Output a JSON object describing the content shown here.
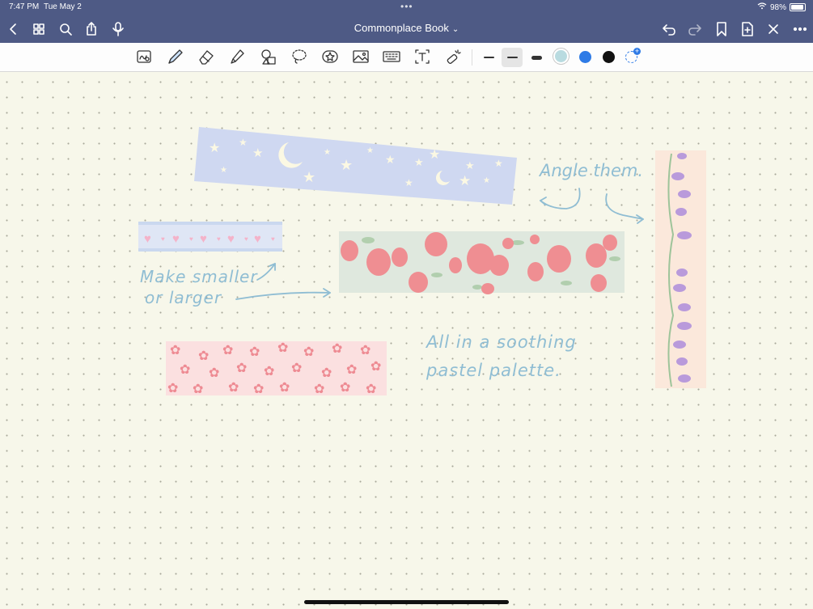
{
  "status": {
    "time": "7:47 PM",
    "date": "Tue May 2",
    "battery": "98%"
  },
  "header": {
    "title": "Commonplace Book"
  },
  "annotations": {
    "angle": "Angle them.",
    "resize_line1": "Make smaller",
    "resize_line2": "or larger",
    "palette_line1": "All in a soothing",
    "palette_line2": "pastel palette."
  },
  "colors": {
    "bar": "#4e5a85",
    "ink": "#8fbdd3",
    "swatches": [
      "#b9dbe0",
      "#2f7be6",
      "#111111"
    ]
  },
  "icons": [
    "back-icon",
    "grid-icon",
    "search-icon",
    "share-icon",
    "mic-icon",
    "undo-icon",
    "redo-icon",
    "bookmark-icon",
    "add-page-icon",
    "close-icon",
    "more-icon"
  ]
}
